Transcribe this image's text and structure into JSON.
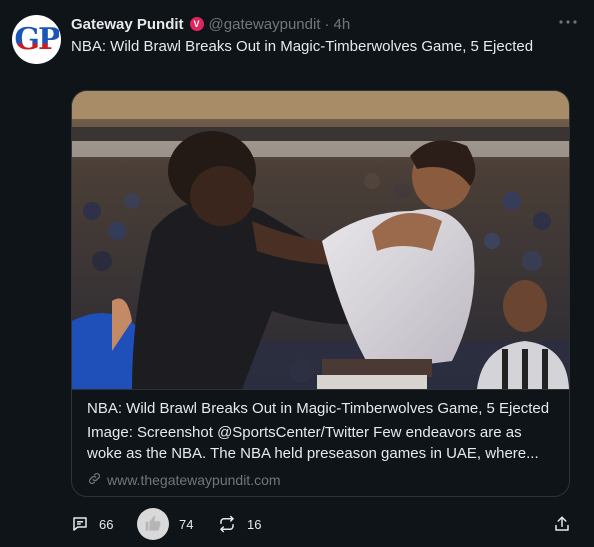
{
  "author": {
    "avatar_text": "GP",
    "name": "Gateway Pundit",
    "verified_badge": "V",
    "handle": "@gatewaypundit",
    "separator": "·",
    "time": "4h"
  },
  "post": {
    "text": "NBA: Wild Brawl Breaks Out in Magic-Timberwolves Game, 5 Ejected"
  },
  "card": {
    "image_alt": "Photo of two basketball players fighting on court",
    "title": "NBA: Wild Brawl Breaks Out in Magic-Timberwolves Game, 5 Ejected",
    "description": "Image: Screenshot @SportsCenter/Twitter Few endeavors are as woke as the NBA. The NBA held preseason games in UAE,  where...",
    "domain": "www.thegatewaypundit.com"
  },
  "actions": {
    "replies": "66",
    "likes": "74",
    "reposts": "16"
  },
  "colors": {
    "background": "#0f1419",
    "text": "#e7e9ea",
    "muted": "#71767b",
    "border": "#2f3336",
    "badge": "#e0245e",
    "avatar_blue": "#1a56b5",
    "avatar_red": "#c91c22"
  },
  "icons": [
    "more-icon",
    "link-icon",
    "reply-icon",
    "like-icon",
    "repost-icon",
    "share-icon",
    "verified-badge-icon"
  ]
}
